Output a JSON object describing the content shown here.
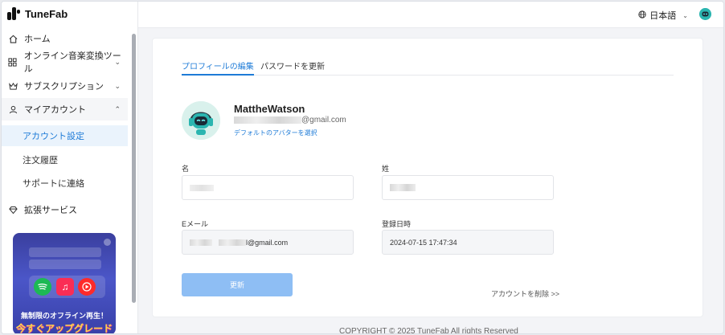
{
  "brand": {
    "name": "TuneFab"
  },
  "sidebar": {
    "home": "ホーム",
    "online_converter": "オンライン音楽変換ツール",
    "subscription": "サブスクリプション",
    "my_account": "マイアカウント",
    "sub_items": [
      "アカウント設定",
      "注文履歴",
      "サポートに連絡"
    ],
    "extensions": "拡張サービス"
  },
  "promo": {
    "line1": "無制限のオフライン再生！",
    "line2": "今すぐアップグレード",
    "apps": [
      "spotify-icon",
      "apple-music-icon",
      "youtube-music-icon"
    ]
  },
  "topbar": {
    "language": "日本語"
  },
  "tabs": {
    "profile": "プロフィールの編集",
    "password": "パスワードを更新"
  },
  "profile": {
    "username": "MattheWatson",
    "email_suffix": "@gmail.com",
    "choose_avatar": "デフォルトのアバターを選択"
  },
  "form": {
    "first_name_label": "名",
    "last_name_label": "姓",
    "email_label": "Eメール",
    "email_value": "l@gmail.com",
    "registered_label": "登録日時",
    "registered_value": "2024-07-15 17:47:34",
    "update_button": "更新",
    "delete_account": "アカウントを削除 >>"
  },
  "footer": {
    "copyright": "COPYRIGHT © 2025 TuneFab All rights Reserved"
  },
  "colors": {
    "accent": "#1e7bd7",
    "button": "#8ebef4",
    "active_bg": "#eaf3fc"
  }
}
